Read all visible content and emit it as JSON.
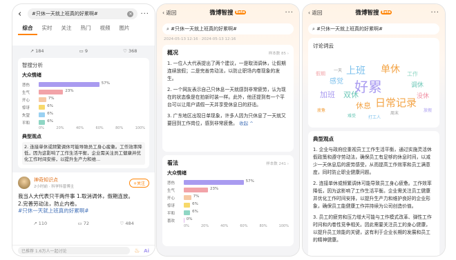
{
  "phone1": {
    "search_text": "#只休一天就上班真的好累啊#",
    "tabs": [
      "综合",
      "实时",
      "关注",
      "热门",
      "视频",
      "图片"
    ],
    "stats": {
      "shares": "184",
      "comments": "9",
      "likes": "368"
    },
    "analysis_title": "智搜分析",
    "sentiment_title": "大众情绪",
    "sentiments": [
      {
        "label": "悲伤",
        "percent": 57,
        "value_text": "57%",
        "color": "#a99bf0"
      },
      {
        "label": "生气",
        "percent": 23,
        "value_text": "23%",
        "color": "#f2a3a8"
      },
      {
        "label": "开心",
        "percent": 7,
        "value_text": "7%",
        "color": "#f6c9a4"
      },
      {
        "label": "惊讶",
        "percent": 6,
        "value_text": "6%",
        "color": "#f7d96b"
      },
      {
        "label": "失望",
        "percent": 6,
        "value_text": "6%",
        "color": "#9ad1f2"
      },
      {
        "label": "平和",
        "percent": 6,
        "value_text": "6%",
        "color": "#8fd6c4"
      }
    ],
    "axis": [
      "0%",
      "20%",
      "40%",
      "60%",
      "80%",
      "100%"
    ],
    "viewpoint_title": "典型观点",
    "viewpoint_text": "2. 连接单休或频繁调休可能导致员工身心疲惫。工作效率降低，因为这影响了工作生活平衡，企业需关注员工健康并优化工作时间安排，以提升生产力和维...",
    "post": {
      "name": "神奇知识点",
      "tag": "神奇知识点",
      "meta": "2小时前 · 科学科普博主",
      "follow": "+关注",
      "body_lines": [
        "我当人大代表只干两件事 1.取消调休，假期连放。",
        "2.完善劳动法，防止内卷。"
      ],
      "hashtag": "#只休一天就上班真的好累啊#",
      "actions": [
        "110",
        "72",
        "484"
      ]
    },
    "comment_placeholder": "已推荐 1.6万人一起讨论"
  },
  "phone2": {
    "back": "返回",
    "title": "微博智搜",
    "beta": "Beta",
    "query": "#只休一天就上班真的好累啊#",
    "meta": "2024-05-13 12:16 · 2024-05-13 12:16",
    "overview_title": "概况",
    "overview_sub": "样本数 85 ›",
    "overview_paras": [
      "1. 一位人大代表提出了两个建议，一是取消调休，让假期连续放假；二是完善劳动法，以防止职场内卷现象的发生。",
      "2. 一个网友表示自己只休息一天就感到非常疲劳，认为现在的状态像是在拍新时装一样。此外，他还提到有一个平台可以让用户请假一天并享受休息日的舒适。",
      "3. 广东地区出现日单现象，许多人因为只休息了一天就又要回到工作岗位，感到非常疲惫。"
    ],
    "collapse": "收起 ^",
    "view_title": "看法",
    "view_sub": "样本数 241 ›",
    "sentiment_title": "大众情绪",
    "sentiments": [
      {
        "label": "悲伤",
        "percent": 57,
        "value_text": "57%",
        "color": "#a99bf0"
      },
      {
        "label": "生气",
        "percent": 23,
        "value_text": "23%",
        "color": "#f2a3a8"
      },
      {
        "label": "开心",
        "percent": 7,
        "value_text": "7%",
        "color": "#f6c9a4"
      },
      {
        "label": "惊讶",
        "percent": 6,
        "value_text": "6%",
        "color": "#f7d96b"
      },
      {
        "label": "平和",
        "percent": 6,
        "value_text": "6%",
        "color": "#8fd6c4"
      },
      {
        "label": "喜欢",
        "percent": 0,
        "value_text": "0%",
        "color": "#e2b7f0"
      }
    ],
    "axis": [
      "0%",
      "20%",
      "40%",
      "60%",
      "80%",
      "100%"
    ]
  },
  "phone3": {
    "back": "返回",
    "title": "微博智搜",
    "beta": "Beta",
    "query": "#只休一天就上班真的好累啊#",
    "cloud_title": "讨论词云",
    "cloud_words": [
      {
        "text": "好累",
        "color": "#a99bf0",
        "size": 20
      },
      {
        "text": "上班",
        "color": "#7cc0ec",
        "size": 14
      },
      {
        "text": "单休",
        "color": "#f3a447",
        "size": 14
      },
      {
        "text": "日常记录",
        "color": "#f3a447",
        "size": 15
      },
      {
        "text": "加班",
        "color": "#a99bf0",
        "size": 11
      },
      {
        "text": "双休",
        "color": "#6cc7b7",
        "size": 11
      },
      {
        "text": "休息",
        "color": "#f3a447",
        "size": 11
      },
      {
        "text": "调休",
        "color": "#6cc7b7",
        "size": 9
      },
      {
        "text": "感觉",
        "color": "#7cc0ec",
        "size": 10
      },
      {
        "text": "没休",
        "color": "#f08ca0",
        "size": 9
      },
      {
        "text": "工作",
        "color": "#8fd6c4",
        "size": 8
      },
      {
        "text": "假期",
        "color": "#f2a3a8",
        "size": 7
      },
      {
        "text": "一天",
        "color": "#999",
        "size": 6
      },
      {
        "text": "周末",
        "color": "#999",
        "size": 6
      },
      {
        "text": "放假",
        "color": "#a99bf0",
        "size": 6
      },
      {
        "text": "疲惫",
        "color": "#f3a447",
        "size": 6
      },
      {
        "text": "难受",
        "color": "#6cc7b7",
        "size": 6
      },
      {
        "text": "打工人",
        "color": "#7cc0ec",
        "size": 6
      }
    ],
    "viewpoint_title": "典型观点",
    "viewpoint_paras": [
      "1. 企业与政府应重视员工工作生活平衡，通过实施灵活休假政策和遵守劳动法，确保员工有足够的休息时间，以减少一天休息后的疲劳感受，从而提高工作效率和员工满意度，同时防止职业健康问题。",
      "2. 连接单休或频繁调休可能导致员工身心疲惫。工作效率降低，因为这影响了工作生活平衡。企业需关注员工健康并优化工作时间安排，以提升生产力和维护良好的企业形象，确保员工能健康工作并持续为公司创造价值。",
      "3. 员工的疲劳和压力增大可能与工作模式改革、弹性工作时间和内卷性竞争相关。因此需要关注员工的身心健康，以提升员工效能的关键，这有利于企业长期的发展和员工的精神健康。"
    ]
  }
}
